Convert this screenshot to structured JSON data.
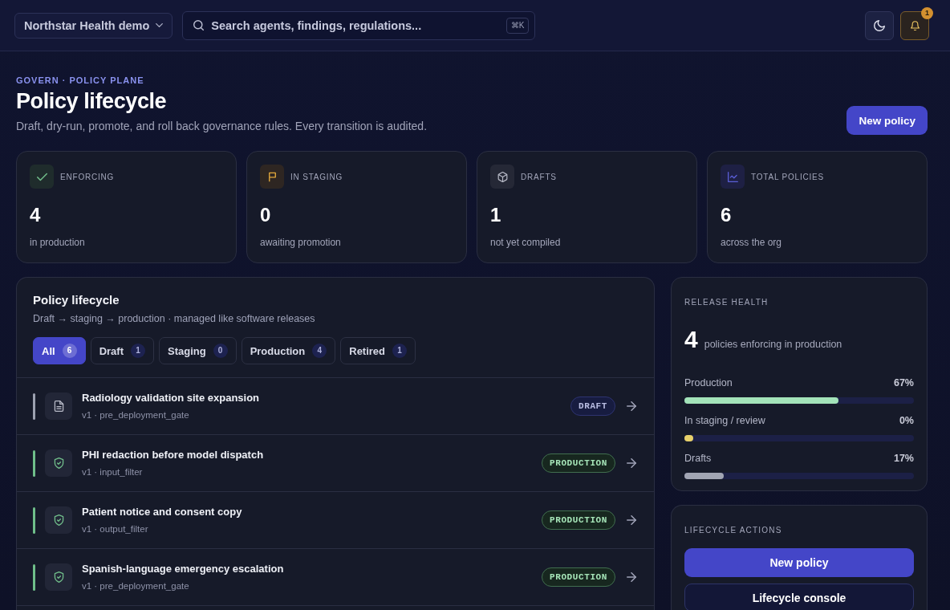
{
  "top_bar": {
    "org_selector": {
      "label": "Northstar Health demo"
    },
    "search": {
      "placeholder": "Search agents, findings, regulations...",
      "shortcut": "⌘K"
    },
    "notifications": {
      "count": "1"
    }
  },
  "header": {
    "eyebrow": "GOVERN · POLICY PLANE",
    "title": "Policy lifecycle",
    "subtitle": "Draft, dry-run, promote, and roll back governance rules. Every transition is audited.",
    "action": "New policy"
  },
  "stats": [
    {
      "kind": "enforcing",
      "label": "ENFORCING",
      "value": "4",
      "caption": "in production"
    },
    {
      "kind": "staging",
      "label": "IN STAGING",
      "value": "0",
      "caption": "awaiting promotion"
    },
    {
      "kind": "drafts",
      "label": "DRAFTS",
      "value": "1",
      "caption": "not yet compiled"
    },
    {
      "kind": "total",
      "label": "TOTAL POLICIES",
      "value": "6",
      "caption": "across the org"
    }
  ],
  "lifecycle_panel": {
    "title": "Policy lifecycle",
    "subtitle": "Draft → staging → production · managed like software releases",
    "filters": [
      {
        "label": "All",
        "count": "6",
        "selected": true
      },
      {
        "label": "Draft",
        "count": "1",
        "selected": false
      },
      {
        "label": "Staging",
        "count": "0",
        "selected": false
      },
      {
        "label": "Production",
        "count": "4",
        "selected": false
      },
      {
        "label": "Retired",
        "count": "1",
        "selected": false
      }
    ],
    "policies": [
      {
        "kind": "draft",
        "title": "Radiology validation site expansion",
        "meta": "v1 · pre_deployment_gate",
        "badge": "DRAFT"
      },
      {
        "kind": "production",
        "title": "PHI redaction before model dispatch",
        "meta": "v1 · input_filter",
        "badge": "PRODUCTION"
      },
      {
        "kind": "production",
        "title": "Patient notice and consent copy",
        "meta": "v1 · output_filter",
        "badge": "PRODUCTION"
      },
      {
        "kind": "production",
        "title": "Spanish-language emergency escalation",
        "meta": "v1 · pre_deployment_gate",
        "badge": "PRODUCTION"
      }
    ]
  },
  "release_health": {
    "title": "RELEASE HEALTH",
    "value": "4",
    "caption": "policies enforcing in production",
    "bars": [
      {
        "label": "Production",
        "reading": "67%",
        "level": 0.67,
        "color": "#a3e3b9"
      },
      {
        "label": "In staging / review",
        "reading": "0%",
        "level": 0,
        "color": "#e7d06a"
      },
      {
        "label": "Drafts",
        "reading": "17%",
        "level": 0.17,
        "color": "#a1a5b3"
      }
    ]
  },
  "lifecycle_actions": {
    "title": "LIFECYCLE ACTIONS",
    "buttons": [
      {
        "kind": "primary",
        "label": "New policy"
      },
      {
        "kind": "secondary",
        "label": "Lifecycle console"
      }
    ]
  }
}
